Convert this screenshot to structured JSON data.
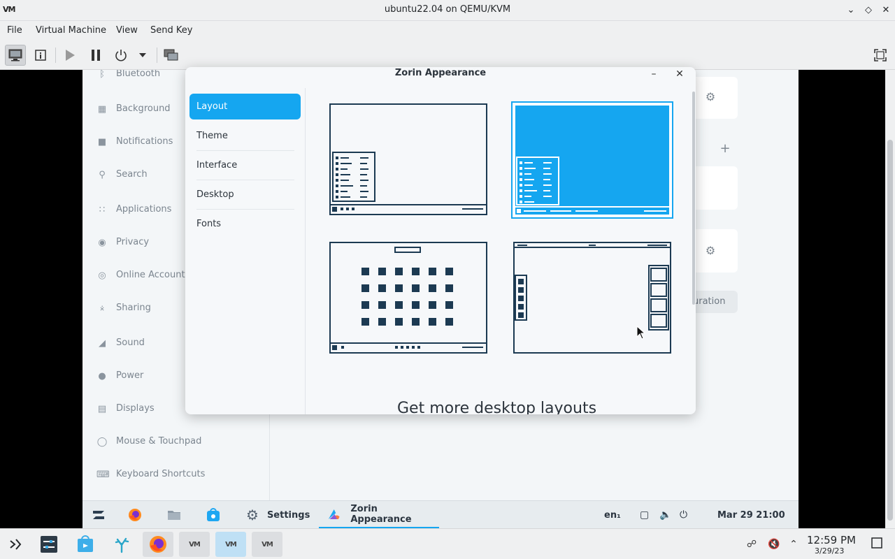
{
  "window": {
    "title": "ubuntu22.04 on QEMU/KVM",
    "logo_text": "VM"
  },
  "menu": {
    "items": [
      "File",
      "Virtual Machine",
      "View",
      "Send Key"
    ]
  },
  "settings_sidebar": {
    "items": [
      {
        "label": "Bluetooth",
        "icon": "bluetooth-icon"
      },
      {
        "label": "Background",
        "icon": "background-icon"
      },
      {
        "label": "Notifications",
        "icon": "notifications-icon"
      },
      {
        "label": "Search",
        "icon": "search-icon"
      },
      {
        "label": "Applications",
        "icon": "applications-icon"
      },
      {
        "label": "Privacy",
        "icon": "privacy-icon"
      },
      {
        "label": "Online Accounts",
        "icon": "online-accounts-icon"
      },
      {
        "label": "Sharing",
        "icon": "sharing-icon"
      },
      {
        "label": "Sound",
        "icon": "sound-icon"
      },
      {
        "label": "Power",
        "icon": "power-icon"
      },
      {
        "label": "Displays",
        "icon": "displays-icon"
      },
      {
        "label": "Mouse & Touchpad",
        "icon": "mouse-icon"
      },
      {
        "label": "Keyboard Shortcuts",
        "icon": "keyboard-icon"
      }
    ]
  },
  "settings_main": {
    "config_button_text": "uration"
  },
  "dialog": {
    "title": "Zorin Appearance",
    "nav": [
      "Layout",
      "Theme",
      "Interface",
      "Desktop",
      "Fonts"
    ],
    "selected_nav": "Layout",
    "selected_layout_index": 1,
    "more_layouts_text": "Get more desktop layouts"
  },
  "guest_panel": {
    "tasks": [
      {
        "label": "Settings",
        "icon": "settings-gear-icon"
      },
      {
        "label": "Zorin Appearance",
        "icon": "zorin-appearance-icon"
      }
    ],
    "keyboard_layout": "en₁",
    "datetime": "Mar 29  21:00"
  },
  "host_taskbar": {
    "time": "12:59 PM",
    "date": "3/29/23",
    "vm_label": "VM"
  },
  "colors": {
    "accent": "#15a6f0",
    "layout_stroke": "#1c3a52"
  }
}
